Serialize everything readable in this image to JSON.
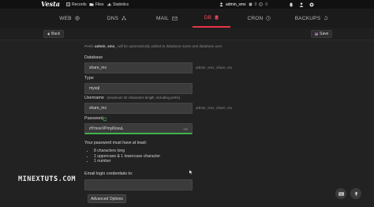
{
  "app": {
    "logo": "Vesta"
  },
  "topnav": {
    "records": "Records",
    "files": "Files",
    "statistics": "Statistics"
  },
  "user": {
    "name": "admin_smx",
    "stat1": "0",
    "stat2": "0"
  },
  "tabs": [
    {
      "label": "WEB"
    },
    {
      "label": "DNS"
    },
    {
      "label": "MAIL"
    },
    {
      "label": "DB"
    },
    {
      "label": "CRON"
    },
    {
      "label": "BACKUPS"
    }
  ],
  "toolbar": {
    "back_label": "Back",
    "save_label": "Save"
  },
  "form": {
    "prefix_hint_pre": "Prefix",
    "prefix_value": "admin_smx_",
    "prefix_hint_post": "will be automatically added to database name and database user",
    "database_label": "Database",
    "database_value": "share_mx",
    "database_suffix": "admin_smx_share_mx",
    "type_label": "Type",
    "type_value": "mysql",
    "username_label": "Username",
    "username_note": "(maximum 32 characters length, including prefix)",
    "username_value": "share_mx",
    "username_suffix": "admin_smx_share_mx",
    "password_label": "Password",
    "password_value": "dYmoeVPmyl0oxuL",
    "password_length": "15/",
    "requirements_title": "Your password must have at least:",
    "requirements": [
      "8 characters long",
      "1 uppercase & 1 lowercase character",
      "1 number"
    ],
    "email_label": "Email login credentials to:",
    "email_value": "",
    "advanced_label": "Advanced Options"
  },
  "watermark": {
    "part1": "MINEX",
    "part2": "TUTS",
    "part3": ".COM"
  },
  "colors": {
    "accent": "#e8334a",
    "success": "#3fb34f",
    "background": "#222222"
  }
}
